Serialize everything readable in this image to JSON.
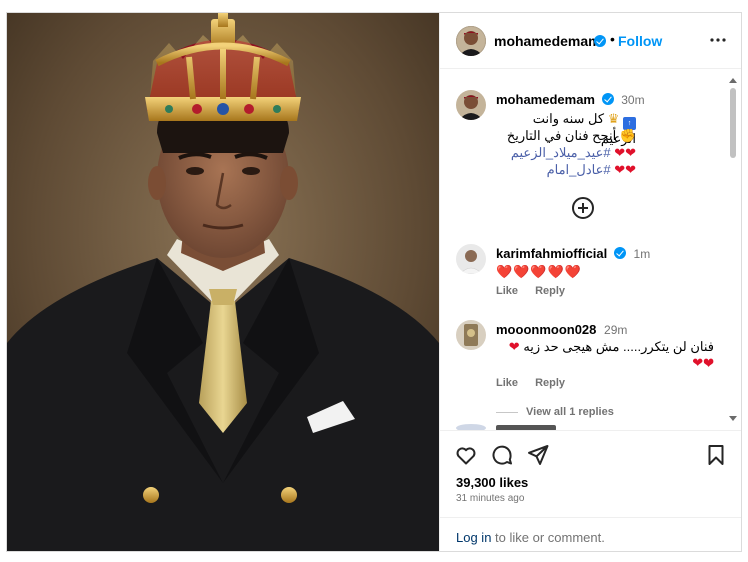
{
  "post": {
    "username": "mohamedemam",
    "follow_label": "Follow",
    "dot": "•"
  },
  "caption": {
    "username": "mohamedemam",
    "time": "30m",
    "line1": "كل سنه وانت الزعيم",
    "line2": "أنجح فنان في التاريخ",
    "hashtag1": "#عيد_ميلاد_الزعيم",
    "hashtag2": "#عادل_امام"
  },
  "comments": [
    {
      "username": "karimfahmiofficial",
      "time": "1m",
      "text": "❤️❤️❤️❤️❤️",
      "like_label": "Like",
      "reply_label": "Reply"
    },
    {
      "username": "mooonmoon028",
      "time": "29m",
      "text": "فنان لن يتكرر..... مش هيجى حد زيه",
      "like_label": "Like",
      "reply_label": "Reply",
      "view_replies": "View all 1 replies"
    }
  ],
  "footer": {
    "likes": "39,300 likes",
    "ago": "31 minutes ago",
    "login_link": "Log in",
    "login_text": " to like or comment."
  },
  "colors": {
    "accent": "#0095f6",
    "heart": "#e0112b",
    "hashtag": "#4a5fa8",
    "muted": "#737373"
  },
  "icons": [
    "more-icon",
    "verified-icon",
    "add-comment-icon",
    "heart-icon",
    "comment-icon",
    "share-icon",
    "bookmark-icon",
    "crown-emoji-icon",
    "top-emoji-icon",
    "muscle-emoji-icon"
  ]
}
